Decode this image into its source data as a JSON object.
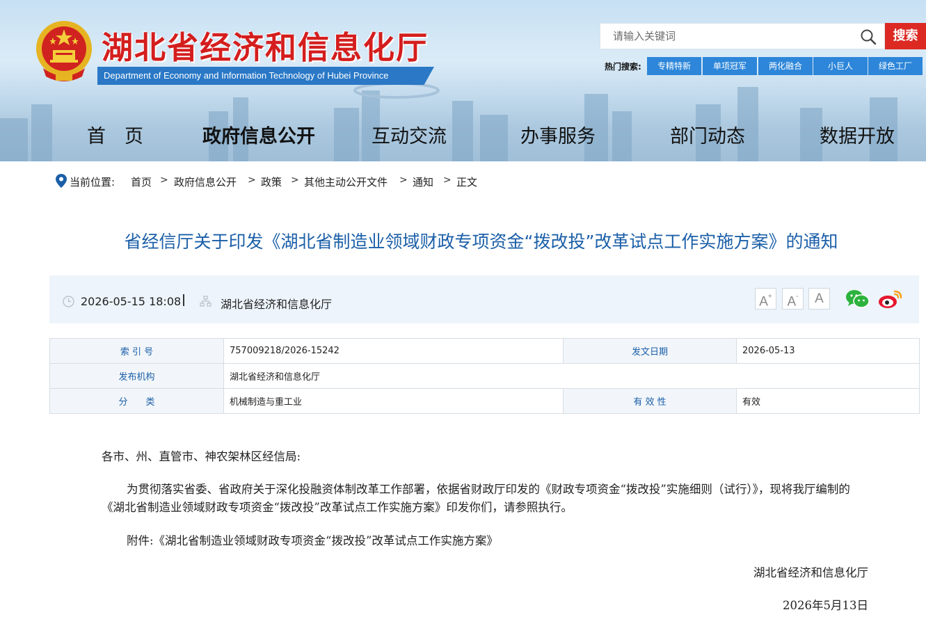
{
  "header": {
    "title": "湖北省经济和信息化厅",
    "subtitle": "Department of Economy and Information Technology of Hubei Province",
    "search_placeholder": "请输入关键词",
    "search_button": "搜索",
    "hot_label": "热门搜索:",
    "hot_tags": [
      "专精特新",
      "单项冠军",
      "两化融合",
      "小巨人",
      "绿色工厂"
    ]
  },
  "nav": {
    "items": [
      "首　页",
      "政府信息公开",
      "互动交流",
      "办事服务",
      "部门动态",
      "数据开放"
    ],
    "active": "政府信息公开"
  },
  "breadcrumb": {
    "label": "当前位置:",
    "items": [
      "首页",
      "政府信息公开",
      "政策",
      "其他主动公开文件",
      "通知",
      "正文"
    ],
    "separator": ">"
  },
  "article": {
    "title": "省经信厅关于印发《湖北省制造业领域财政专项资金“拨改投”改革试点工作实施方案》的通知",
    "datetime": "2026-05-15 18:08",
    "source": "湖北省经济和信息化厅",
    "font_buttons": [
      "A+",
      "A-",
      "A"
    ]
  },
  "info": {
    "index_label": "索 引 号",
    "index_value": "757009218/2026-15242",
    "date_label": "发文日期",
    "date_value": "2026-05-13",
    "publisher_label": "发布机构",
    "publisher_value": "湖北省经济和信息化厅",
    "category_label": "分　　类",
    "category_value": "机械制造与重工业",
    "validity_label": "有 效 性",
    "validity_value": "有效"
  },
  "body": {
    "salutation": "各市、州、直管市、神农架林区经信局:",
    "paragraph": "为贯彻落实省委、省政府关于深化投融资体制改革工作部署，依据省财政厅印发的《财政专项资金“拨改投”实施细则（试行）》，现将我厅编制的《湖北省制造业领域财政专项资金“拨改投”改革试点工作实施方案》印发你们，请参照执行。",
    "attachment": "附件:《湖北省制造业领域财政专项资金“拨改投”改革试点工作实施方案》",
    "signature": "湖北省经济和信息化厅",
    "date": "2026年5月13日"
  },
  "colors": {
    "brand_red": "#d41e1e",
    "title_blue": "#1b5fa8",
    "tag_blue": "#2d86d9",
    "search_red": "#dc2a23"
  }
}
